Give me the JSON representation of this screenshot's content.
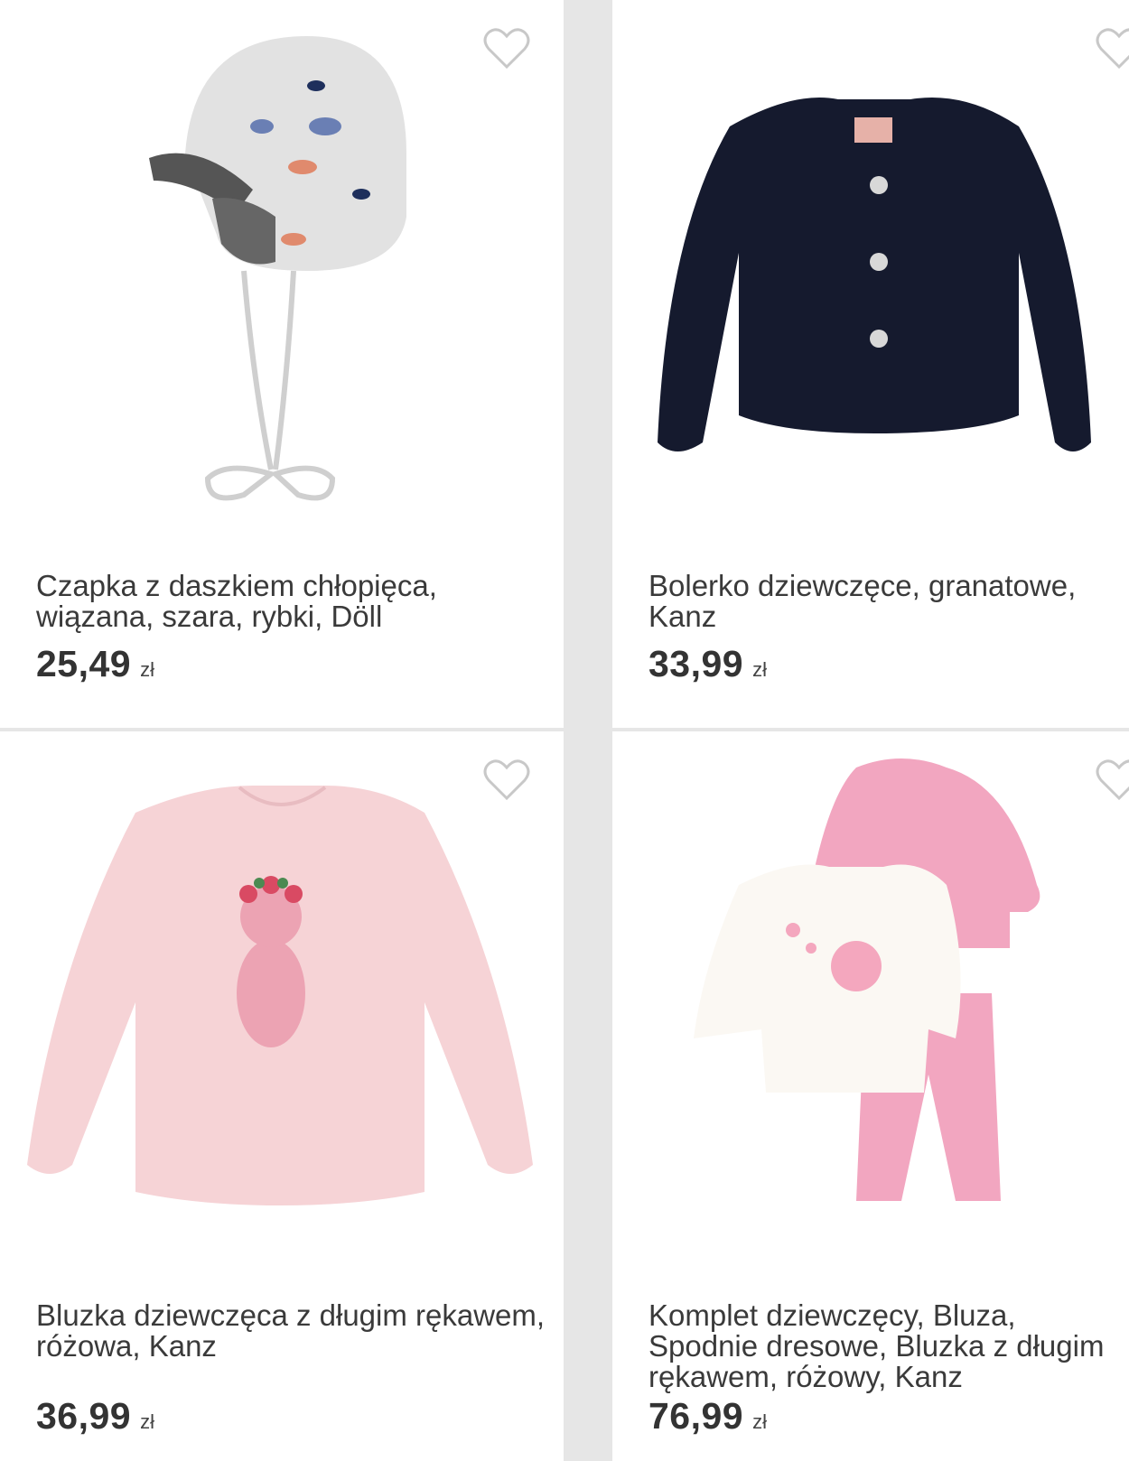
{
  "products": [
    {
      "title": "Czapka z daszkiem chłopięca, wiązana, szara, rybki, Döll",
      "price": "25,49",
      "currency": "zł",
      "image": "baby-cap-grey-fish-print",
      "icon": "heart-outline-icon"
    },
    {
      "title": "Bolerko dziewczęce, granatowe, Kanz",
      "price": "33,99",
      "currency": "zł",
      "image": "navy-knit-bolero",
      "icon": "heart-outline-icon"
    },
    {
      "title": "Bluzka dziewczęca z długim rękawem, różowa, Kanz",
      "price": "36,99",
      "currency": "zł",
      "image": "pink-long-sleeve-top-cat-print",
      "icon": "heart-outline-icon"
    },
    {
      "title": "Komplet dziewczęcy, Bluza, Spodnie dresowe, Bluzka z długim rękawem, różowy, Kanz",
      "price": "76,99",
      "currency": "zł",
      "image": "pink-three-piece-set",
      "icon": "heart-outline-icon"
    }
  ],
  "colors": {
    "background": "#e6e6e6",
    "card": "#ffffff",
    "text": "#3a3a3a",
    "heart": "#c8c8c8"
  }
}
